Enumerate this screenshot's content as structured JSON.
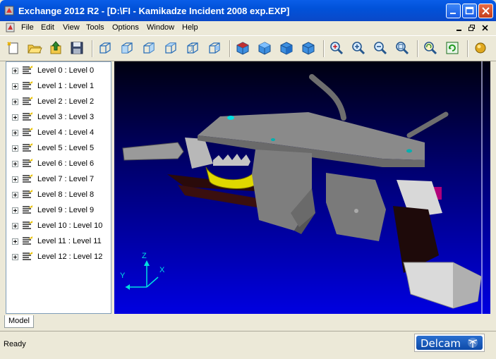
{
  "window": {
    "title": "Exchange 2012 R2 - [D:\\FI - Kamikadze Incident 2008 exp.EXP]"
  },
  "menu": [
    "File",
    "Edit",
    "View",
    "Tools",
    "Options",
    "Window",
    "Help"
  ],
  "toolbar": {
    "icons": [
      "new-icon",
      "open-icon",
      "import-icon",
      "save-icon",
      "view-iso-icon",
      "view-front-icon",
      "view-back-icon",
      "view-left-icon",
      "view-right-icon",
      "view-top-icon",
      "shaded-cube-icon",
      "shaded-cube-2-icon",
      "shaded-cube-3-icon",
      "shaded-cube-4-icon",
      "zoom-all-icon",
      "zoom-in-icon",
      "zoom-out-icon",
      "zoom-box-icon",
      "rotate-icon",
      "refresh-icon",
      "sphere-icon"
    ]
  },
  "tree": {
    "items": [
      "Level 0 : Level 0",
      "Level 1 : Level 1",
      "Level 2 : Level 2",
      "Level 3 : Level 3",
      "Level 4 : Level 4",
      "Level 5 : Level 5",
      "Level 6 : Level 6",
      "Level 7 : Level 7",
      "Level 8 : Level 8",
      "Level 9 : Level 9",
      "Level 10 : Level 10",
      "Level 11 : Level 11",
      "Level 12 : Level 12"
    ]
  },
  "axes": {
    "z": "Z",
    "y": "Y",
    "x": "X"
  },
  "tabs": {
    "model": "Model"
  },
  "status": {
    "text": "Ready"
  },
  "logo": {
    "text": "Delcam"
  },
  "colors": {
    "title_blue": "#0152d9",
    "viewport_top": "#000010",
    "viewport_bottom": "#0000e0",
    "part_gray": "#8c8c8c"
  }
}
